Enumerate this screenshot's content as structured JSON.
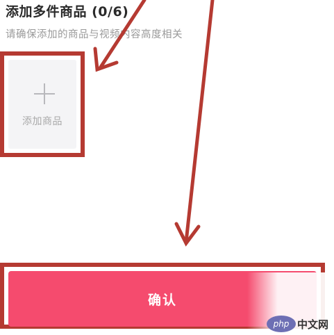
{
  "section": {
    "title": "添加多件商品 (0/6)",
    "subtitle": "请确保添加的商品与视频内容高度相关"
  },
  "add_tile": {
    "label": "添加商品",
    "icon": "plus-icon"
  },
  "confirm": {
    "label": "确认"
  },
  "watermark": {
    "logo": "php",
    "text": "中文网"
  },
  "colors": {
    "accent": "#f54b6e",
    "annotation": "#b53a32",
    "tile_bg": "#f4f4f6"
  }
}
